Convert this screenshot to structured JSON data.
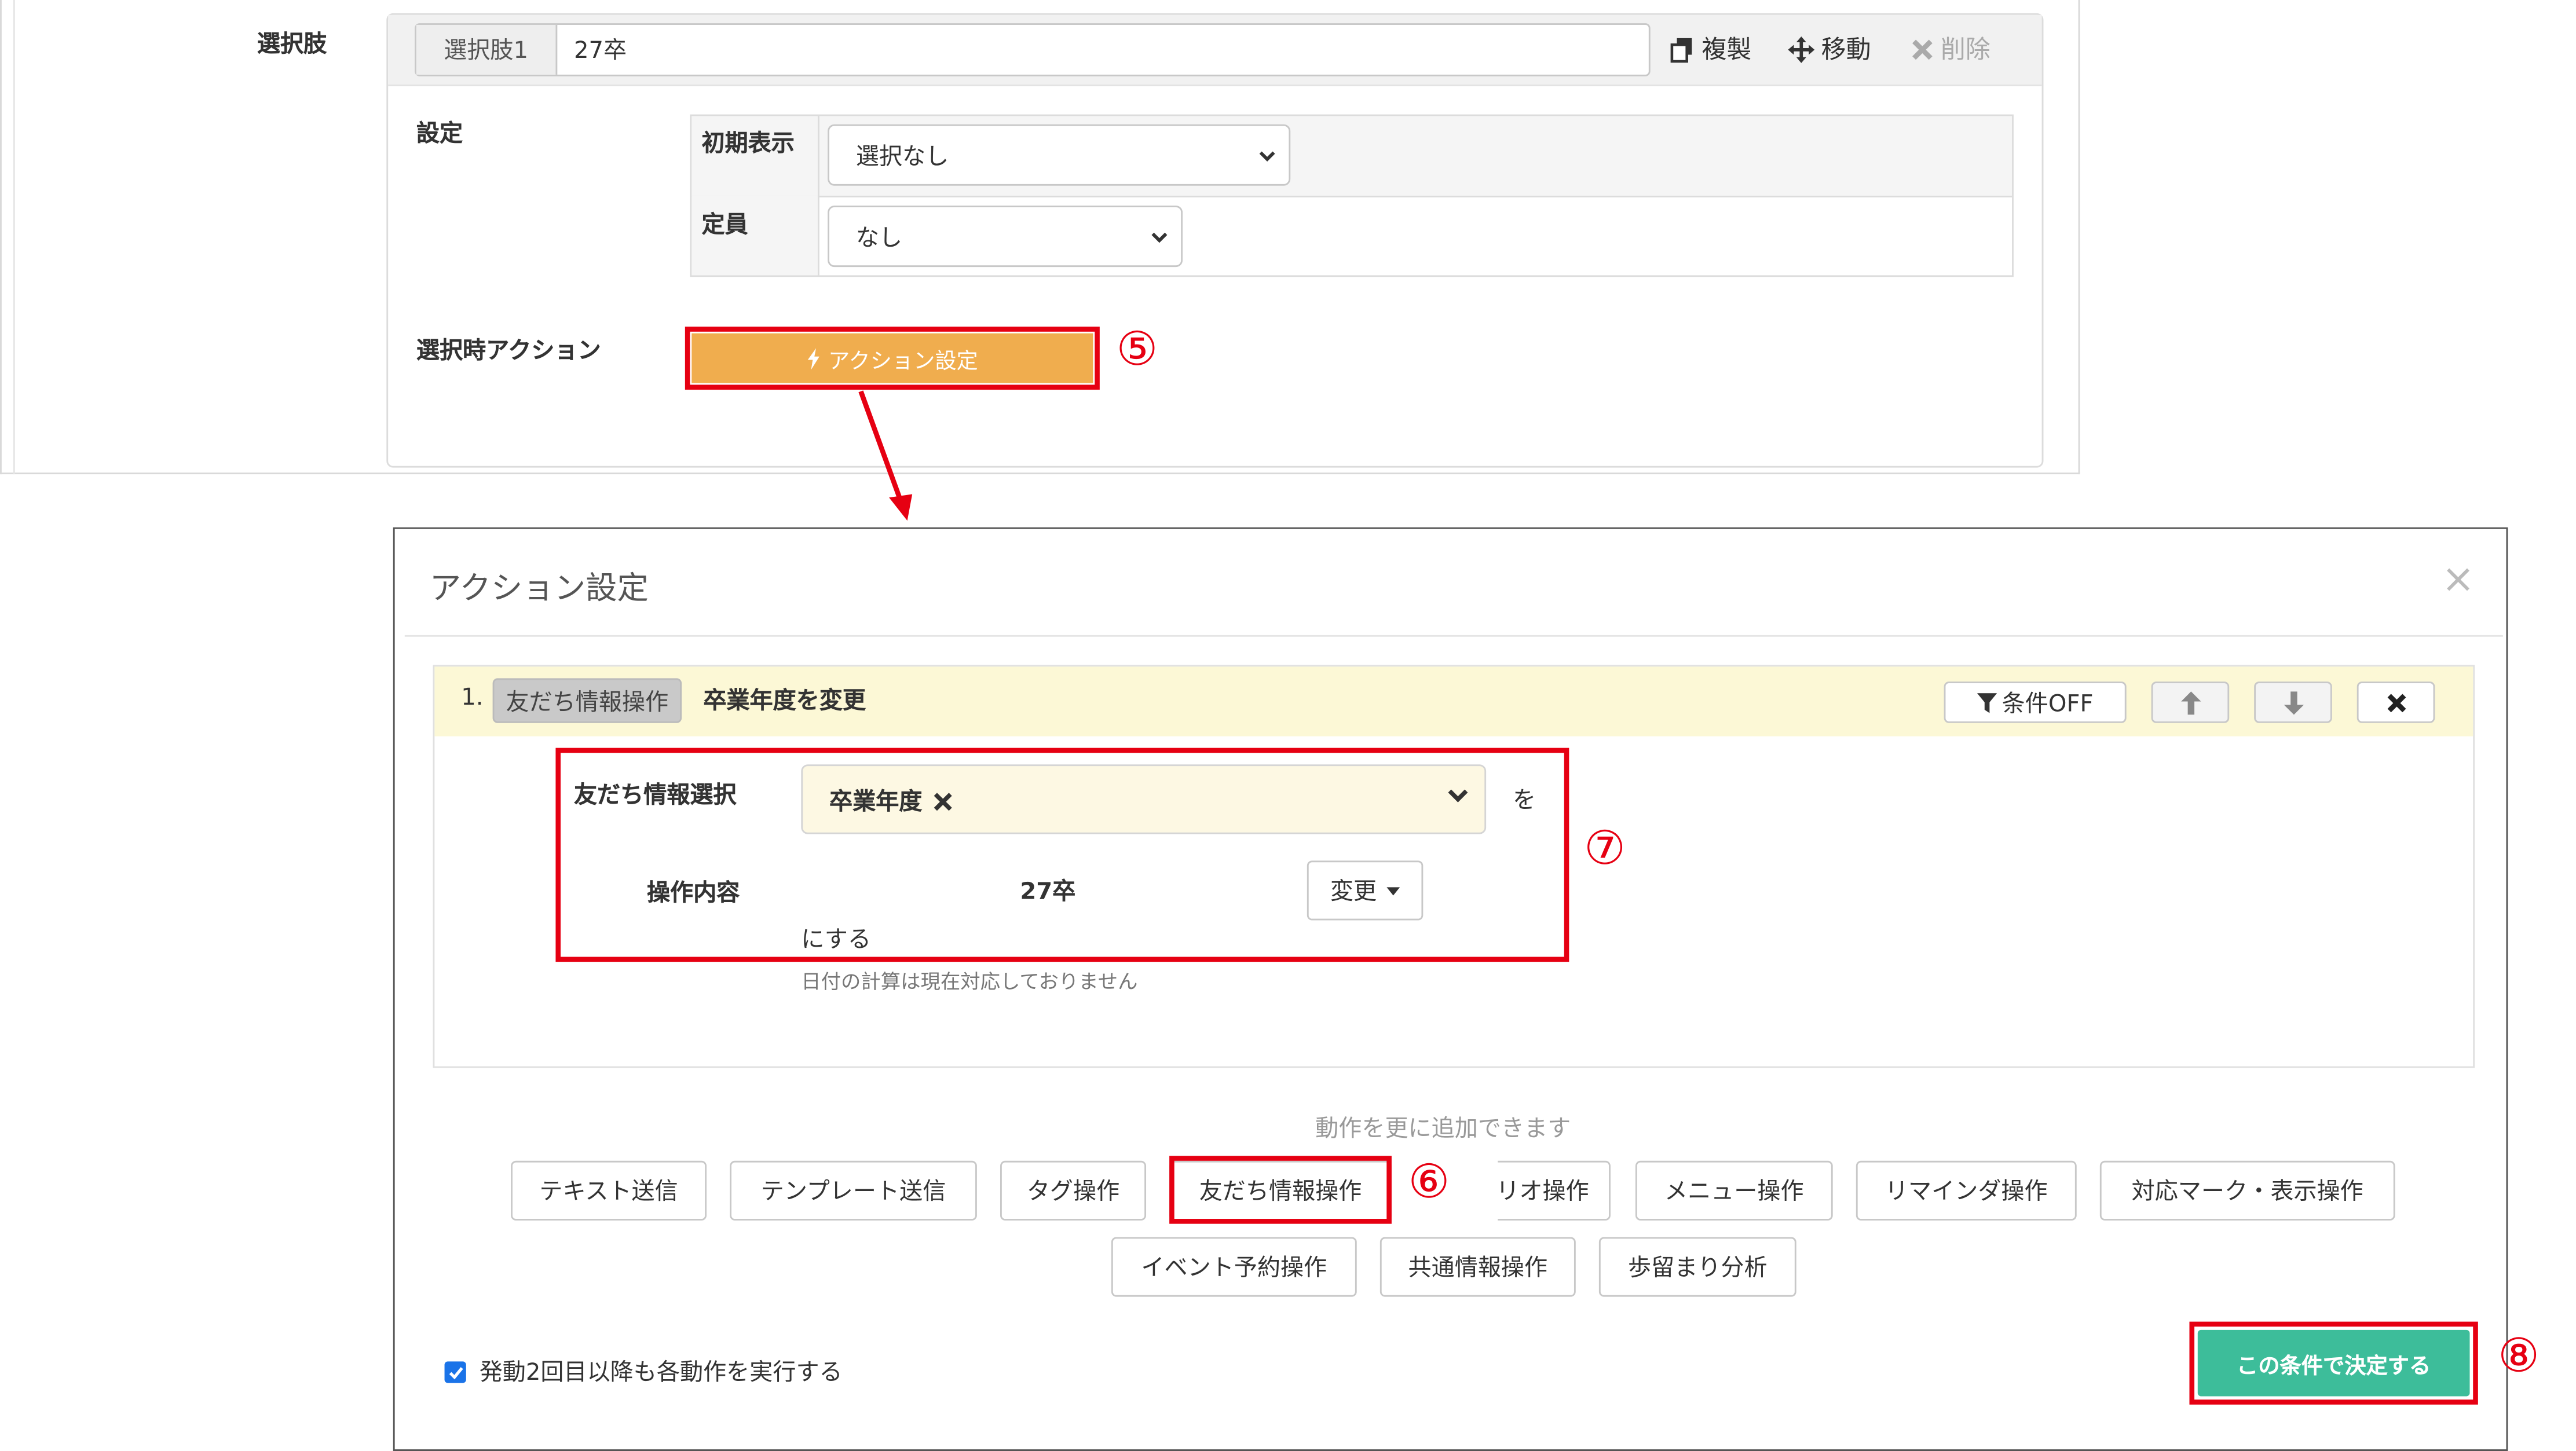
{
  "top_panel": {
    "options_label": "選択肢",
    "option_tag": "選択肢1",
    "option_value": "27卒",
    "copy_label": "複製",
    "move_label": "移動",
    "delete_label": "削除",
    "settings_label": "設定",
    "initial_display_label": "初期表示",
    "initial_display_value": "選択なし",
    "capacity_label": "定員",
    "capacity_value": "なし",
    "select_action_label": "選択時アクション",
    "action_button_label": "アクション設定"
  },
  "callouts": {
    "n5": "⑤",
    "n6": "⑥",
    "n7": "⑦",
    "n8": "⑧"
  },
  "modal": {
    "title": "アクション設定",
    "close_glyph": "×",
    "action": {
      "index": "1.",
      "category_badge": "友だち情報操作",
      "summary": "卒業年度を変更",
      "condition_button": "条件OFF",
      "friend_info_select_label": "友だち情報選択",
      "friend_info_value": "卒業年度",
      "wo_text": "を",
      "operation_label": "操作内容",
      "operation_value": "27卒",
      "change_button": "変更",
      "suffix_text": "にする",
      "note_text": "日付の計算は現在対応しておりません"
    },
    "add_hint": "動作を更に追加できます",
    "action_buttons_row1": [
      "テキスト送信",
      "テンプレート送信",
      "タグ操作",
      "友だち情報操作",
      "リオ操作",
      "メニュー操作",
      "リマインダ操作",
      "対応マーク・表示操作"
    ],
    "action_buttons_row2": [
      "イベント予約操作",
      "共通情報操作",
      "歩留まり分析"
    ],
    "checkbox_label": "発動2回目以降も各動作を実行する",
    "checkbox_checked": true,
    "submit_button": "この条件で決定する"
  },
  "colors": {
    "accent_orange": "#f0ad4e",
    "highlight_red": "#e60012",
    "submit_green": "#3dbd9a",
    "action_header_bg": "#fcf8d6"
  }
}
